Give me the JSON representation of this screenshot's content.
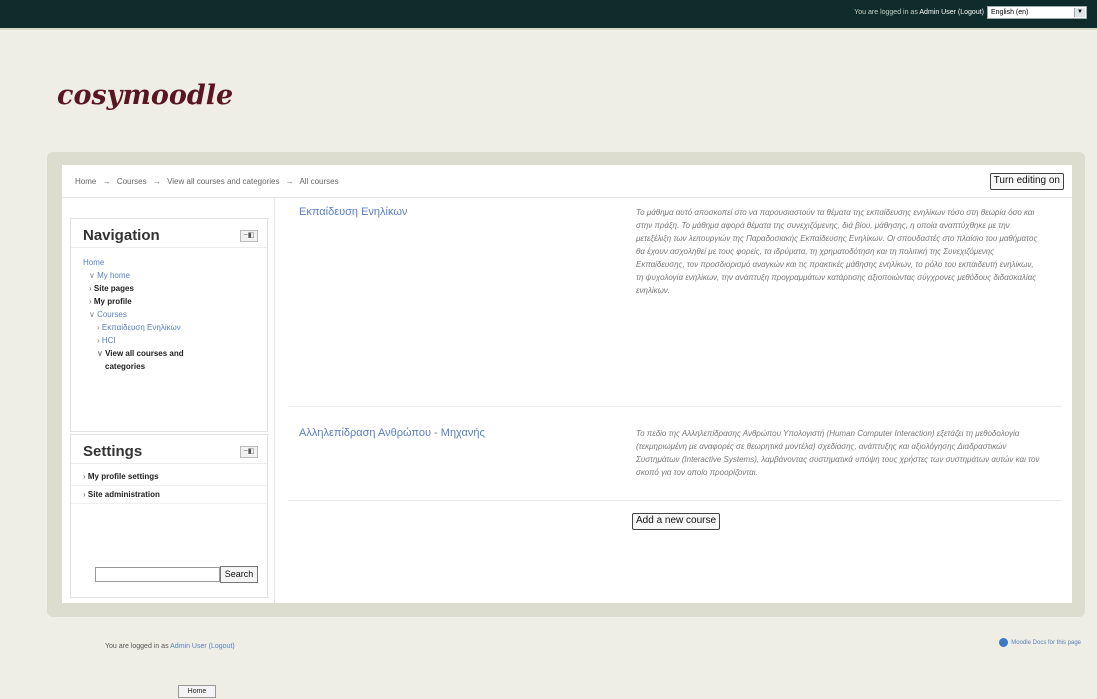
{
  "header": {
    "login_prefix": "You are logged in as",
    "user": "Admin User",
    "logout": "(Logout)",
    "language": "English (en)"
  },
  "site": {
    "name": "cosymoodle"
  },
  "breadcrumb": [
    "Home",
    "→",
    "Courses",
    "→",
    "View all courses and categories",
    "→",
    "All courses"
  ],
  "toolbar": {
    "turn_editing_on": "Turn editing on"
  },
  "navigation": {
    "title": "Navigation",
    "items": [
      {
        "label": "Home",
        "indent": 12,
        "cls": "c-link"
      },
      {
        "label": "My home",
        "indent": 18,
        "bullet": "∨",
        "cls": "c-link"
      },
      {
        "label": "Site pages",
        "indent": 18,
        "bullet": "›",
        "cls": "c-bold"
      },
      {
        "label": "My profile",
        "indent": 18,
        "bullet": "›",
        "cls": "c-bold"
      },
      {
        "label": "Courses",
        "indent": 18,
        "bullet": "∨",
        "cls": "c-link"
      },
      {
        "label": "Εκπαίδευση Ενηλίκων",
        "indent": 26,
        "bullet": "›",
        "cls": "c-link"
      },
      {
        "label": "HCI",
        "indent": 26,
        "bullet": "›",
        "cls": "c-link"
      },
      {
        "label": "View all courses and",
        "indent": 26,
        "bullet": "∨",
        "cls": "c-bold"
      },
      {
        "label": "categories",
        "indent": 34,
        "cls": "c-bold"
      }
    ]
  },
  "settings": {
    "title": "Settings",
    "items": [
      {
        "label": "My profile settings",
        "bullet": "›"
      },
      {
        "label": "Site administration",
        "bullet": "›"
      }
    ],
    "search_label": "Search"
  },
  "courses": [
    {
      "name": "Εκπαίδευση Ενηλίκων",
      "summary": "Το μάθημα αυτό αποσκοπεί στο να παρουσιαστούν τα θέματα της εκπαίδευσης ενηλίκων τόσο στη θεωρία όσο και στην πράξη. Το μάθημα αφορά θέματα της συνεχιζόμενης, διά βίου, μάθησης, η οποία αναπτύχθηκε με την μετεξέλιξη των λειτουργιών της Παραδοσιακής Εκπαίδευσης Ενηλίκων. Οι σπουδαστές στο πλαίσιο του μαθήματος θα έχουν ασχοληθεί με τους φορείς, τα ιδρύματα, τη χρηματοδότηση και τη πολιτική της Συνεχιζόμενης Εκπαίδευσης, τον προσδιορισμό αναγκών και τις πρακτικές μάθησης ενηλίκων, το ρόλο του εκπαιδευτή ενηλίκων, τη ψυχολογία ενηλίκων, την ανάπτυξη προγραμμάτων κατάρτισης αξιοποιώντας σύγχρονες μεθόδους διδασκαλίας ενηλίκων."
    },
    {
      "name": "Αλληλεπίδραση Ανθρώπου - Μηχανής",
      "summary": "Το πεδίο της Αλληλεπίδρασης Ανθρώπου Υπολογιστή (Human Computer Interaction) εξετάζει τη μεθοδολογία (τεκμηριωμένη με αναφορές σε θεωρητικά μοντέλα) σχεδίασης, ανάπτυξης και αξιολόγησης Διαδραστικών Συστημάτων (Interactive Systems), λαμβάνοντας συστηματικά υπόψη τους χρήστες των συστημάτων αυτών και τον σκοπό για τον οποίο προορίζονται."
    }
  ],
  "add_course": "Add a new course",
  "footer": {
    "login_prefix": "You are logged in as",
    "user": "Admin User",
    "logout": "(Logout)",
    "docs_link": "Moodle Docs for this page",
    "home_button": "Home"
  }
}
